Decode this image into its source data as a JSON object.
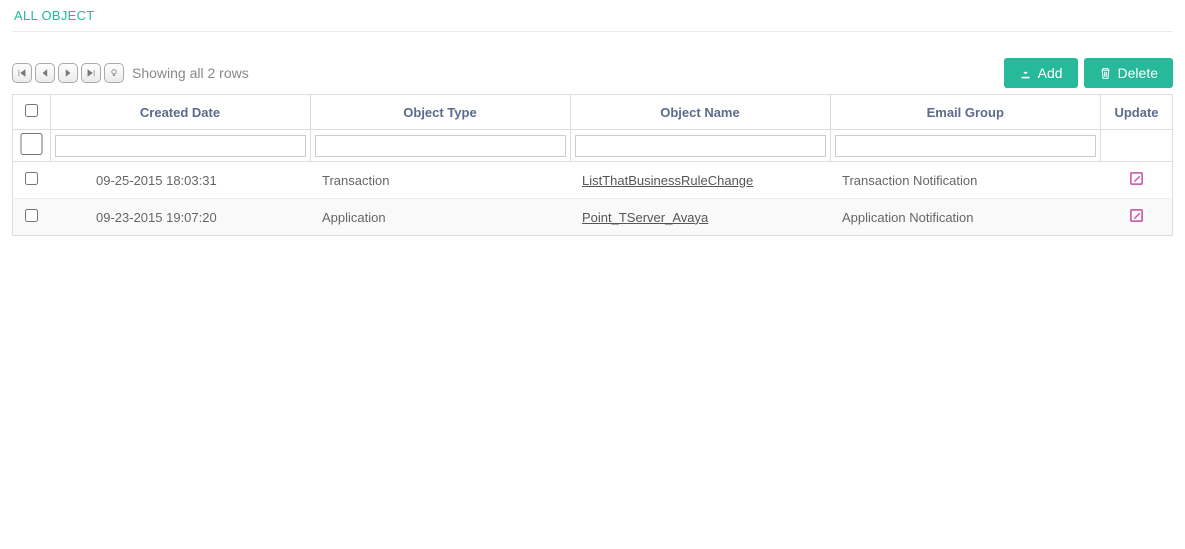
{
  "title": "ALL OBJECT",
  "rowStatus": "Showing all 2 rows",
  "buttons": {
    "add": "Add",
    "delete": "Delete"
  },
  "columns": {
    "created": "Created Date",
    "type": "Object Type",
    "name": "Object Name",
    "group": "Email Group",
    "update": "Update"
  },
  "rows": [
    {
      "created": "09-25-2015 18:03:31",
      "type": "Transaction",
      "name": "ListThatBusinessRuleChange",
      "group": "Transaction Notification"
    },
    {
      "created": "09-23-2015 19:07:20",
      "type": "Application",
      "name": "Point_TServer_Avaya",
      "group": "Application Notification"
    }
  ]
}
